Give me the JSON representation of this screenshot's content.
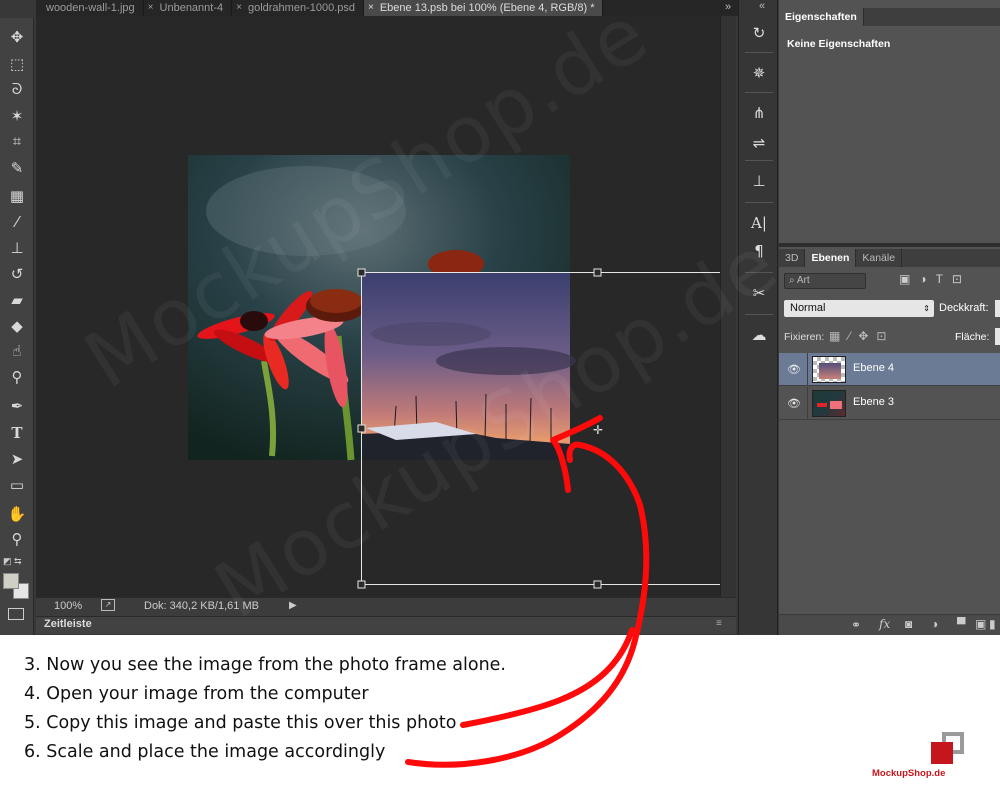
{
  "document_tabs": [
    {
      "label": "wooden-wall-1.jpg",
      "close": "",
      "active": false
    },
    {
      "label": "Unbenannt-4",
      "close": "×",
      "active": false
    },
    {
      "label": "goldrahmen-1000.psd",
      "close": "×",
      "active": false
    },
    {
      "label": "Ebene 13.psb bei 100% (Ebene 4, RGB/8) *",
      "close": "×",
      "active": true
    }
  ],
  "tabs_overflow": "»",
  "tools": [
    "move-tool",
    "marquee-tool",
    "lasso-tool",
    "magic-wand-tool",
    "crop-tool",
    "eyedropper-tool",
    "healing-tool",
    "brush-tool",
    "stamp-tool",
    "history-brush-tool",
    "eraser-tool",
    "paint-bucket-tool",
    "smudge-tool",
    "dodge-tool",
    "pen-tool",
    "type-tool",
    "path-selection-tool",
    "rectangle-tool",
    "hand-tool",
    "zoom-tool"
  ],
  "status": {
    "zoom": "100%",
    "doc_info": "Dok: 340,2 KB/1,61 MB",
    "arrow": "▶"
  },
  "timeline": {
    "label": "Zeitleiste",
    "menu_icon": "≡"
  },
  "properties_panel": {
    "tab": "Eigenschaften",
    "content": "Keine Eigenschaften",
    "collapse": "«"
  },
  "layers_panel": {
    "tabs": [
      "3D",
      "Ebenen",
      "Kanäle"
    ],
    "active_tab": 1,
    "filter_label": "Art",
    "blend_mode": "Normal",
    "opacity_label": "Deckkraft:",
    "lock_label": "Fixieren:",
    "fill_label": "Fläche:",
    "layers": [
      {
        "name": "Ebene 4",
        "selected": true,
        "visible": true
      },
      {
        "name": "Ebene 3",
        "selected": false,
        "visible": true
      }
    ],
    "footer_icons": [
      "link-icon",
      "fx-icon",
      "mask-icon",
      "adjustment-icon",
      "folder-icon",
      "new-layer-icon",
      "trash-icon"
    ]
  },
  "steps": [
    "3. Now you see the image from the photo frame alone.",
    "4. Open your image from the computer",
    "5. Copy this image and paste this over this photo",
    "6. Scale and place the image accordingly"
  ],
  "brand": "MockupShop.de",
  "watermark": "MockupShop.de",
  "colors": {
    "arrow_red": "#ff0a0a",
    "brand_red": "#c4161c",
    "selection": "#e6e6e6"
  }
}
